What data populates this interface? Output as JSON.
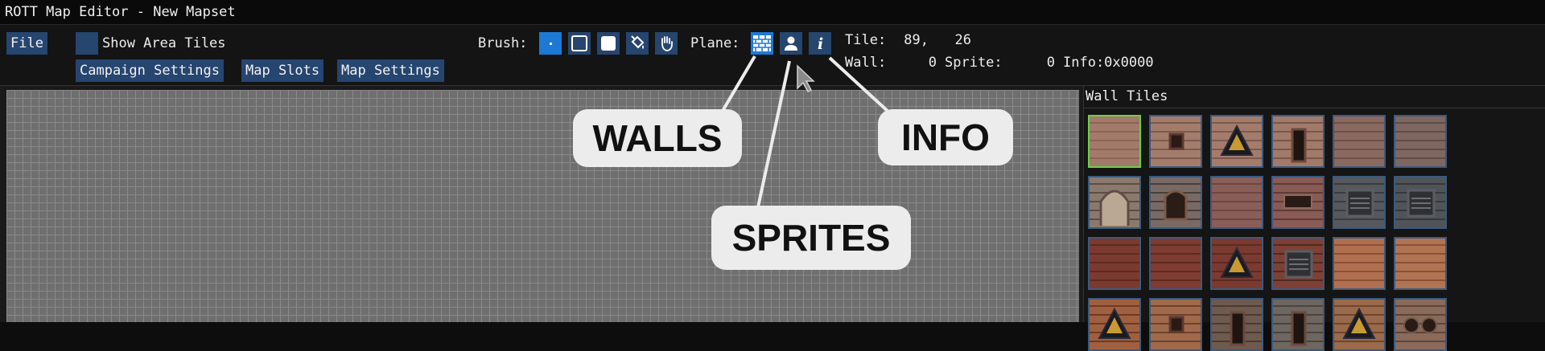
{
  "window": {
    "title": "ROTT Map Editor - New Mapset"
  },
  "toolbar": {
    "file_label": "File",
    "show_area_tiles_label": "Show Area Tiles",
    "campaign_settings_label": "Campaign Settings",
    "map_slots_label": "Map Slots",
    "map_settings_label": "Map Settings",
    "brush_label": "Brush:",
    "plane_label": "Plane:",
    "brush_tools": [
      "brush-point",
      "brush-rectangle-outline",
      "brush-rectangle-filled",
      "brush-fill-bucket",
      "brush-hand"
    ],
    "plane_tools": [
      "walls",
      "sprites",
      "info"
    ]
  },
  "status": {
    "tile_label": "Tile:",
    "tile_x": "89,",
    "tile_y": "26",
    "wall_label": "Wall:",
    "wall_value": "0",
    "sprite_label": "Sprite:",
    "sprite_value": "0",
    "info_label": "Info:0x0000"
  },
  "panel": {
    "title": "Wall Tiles"
  },
  "callouts": {
    "walls": "WALLS",
    "sprites": "SPRITES",
    "info": "INFO"
  },
  "colors": {
    "accent": "#26456f",
    "active": "#1d79d6",
    "selected_tile": "#6ad046"
  }
}
